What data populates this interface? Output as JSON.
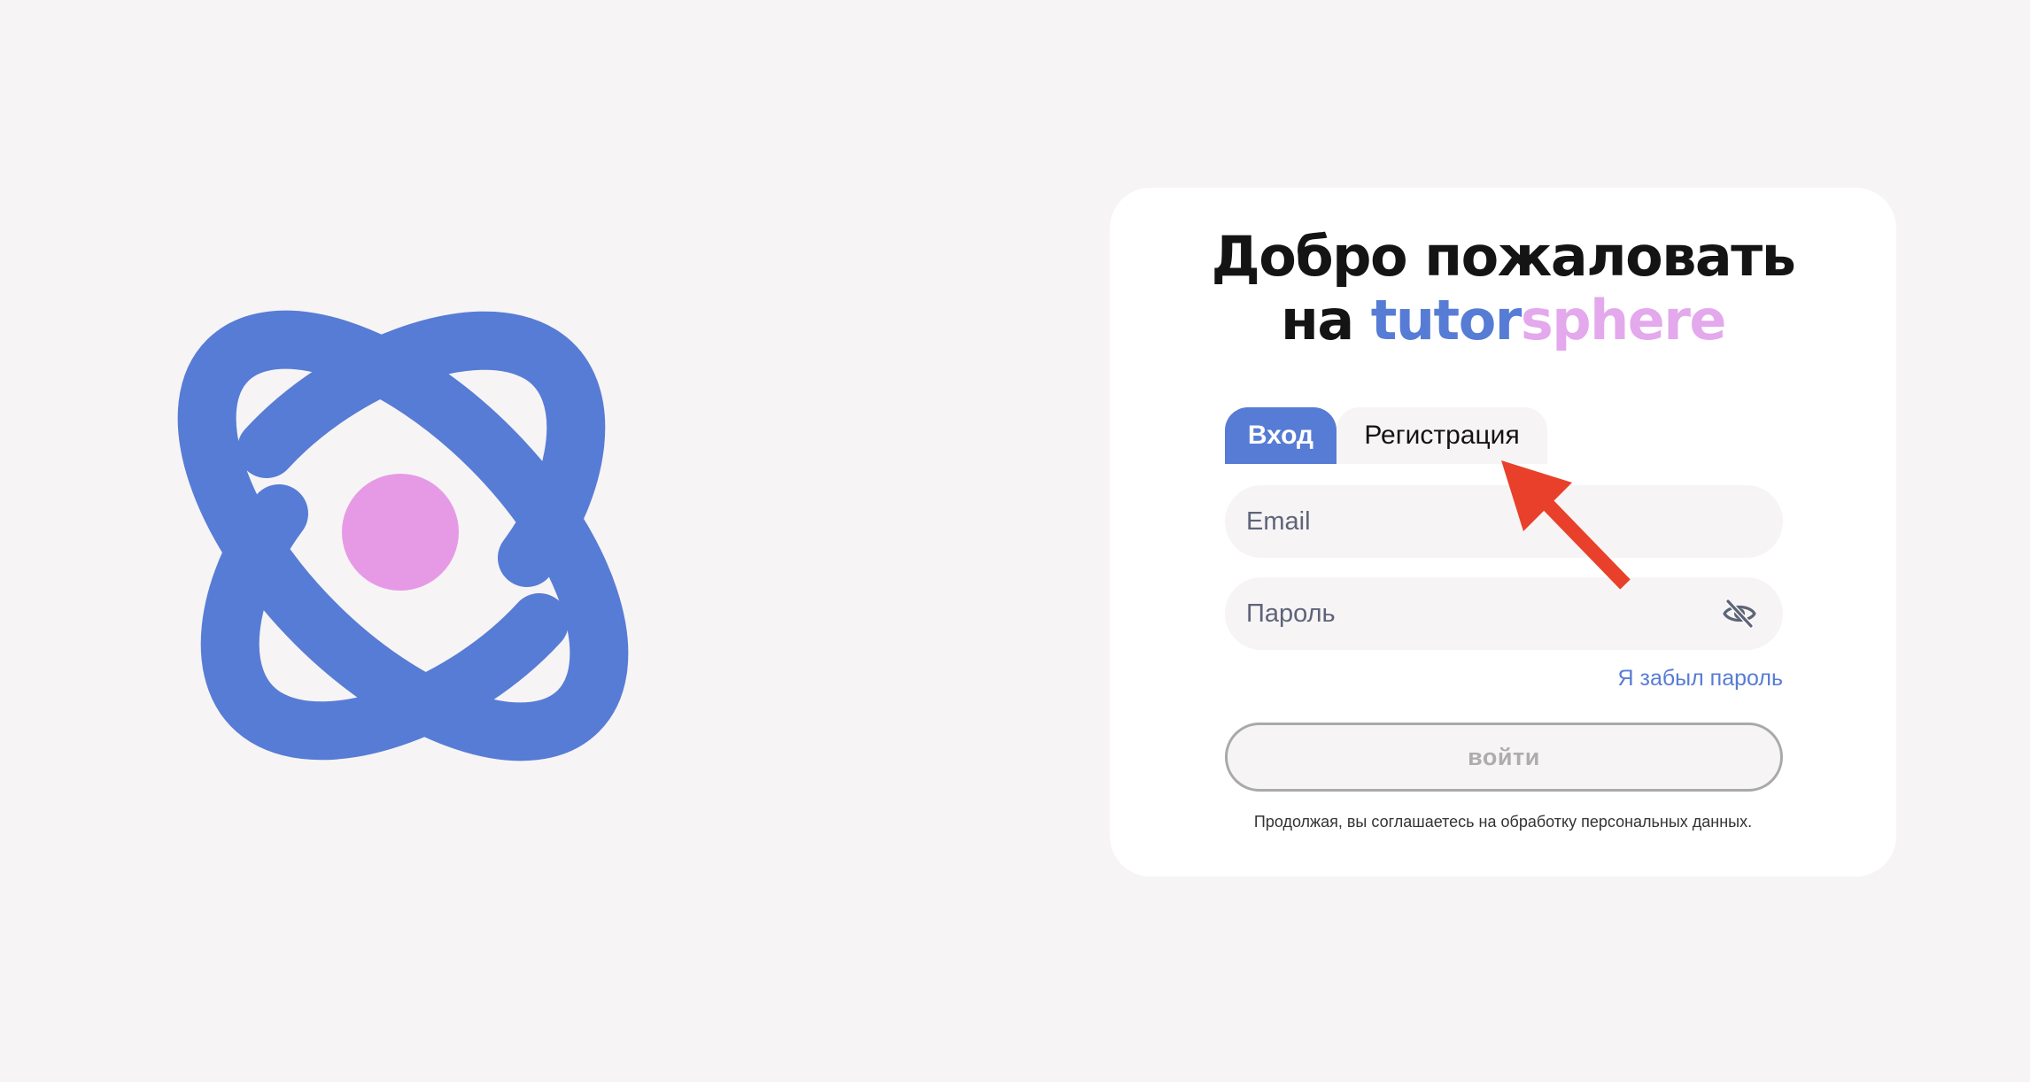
{
  "theme": {
    "background": "#f7f4f5",
    "accent": "#577cd5",
    "brand_secondary": "#e3a9ec",
    "annotation": "#e8402a"
  },
  "logo": {
    "icon": "atom-logo-icon"
  },
  "welcome": {
    "line1": "Добро пожаловать",
    "line2_prefix": "на",
    "brand_part1": "tutor",
    "brand_part2": "sphere"
  },
  "tabs": [
    {
      "label": "Вход",
      "active": true
    },
    {
      "label": "Регистрация",
      "active": false
    }
  ],
  "form": {
    "email_placeholder": "Email",
    "email_value": "",
    "password_placeholder": "Пароль",
    "password_value": "",
    "password_toggle_icon": "eye-off-icon",
    "forgot_link": "Я забыл пароль",
    "submit_label": "войти",
    "consent_text": "Продолжая, вы соглашаетесь на обработку персональных данных."
  },
  "annotation": {
    "icon": "red-arrow-icon"
  }
}
